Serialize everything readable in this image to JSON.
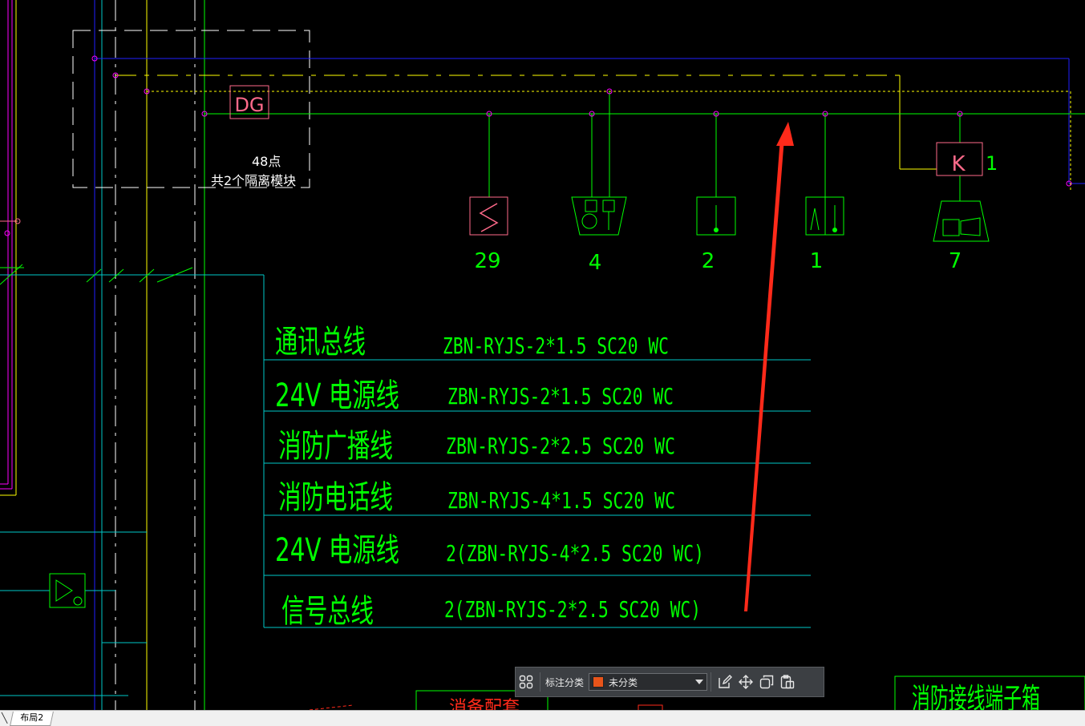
{
  "colors": {
    "background": "#000000",
    "green": "#00ff00",
    "cyan": "#00c8c8",
    "blue": "#2020ff",
    "yellow": "#ffff00",
    "magenta": "#ff00ff",
    "pink": "#ff6a8a",
    "white": "#ffffff",
    "light_green": "#80ff80",
    "red_arrow": "#ff2a1a",
    "toolbar_swatch": "#e8541a"
  },
  "drawing": {
    "dg_label": "DG",
    "dg_points": "48点",
    "dg_modules": "共2个隔离模块",
    "k_label": "K",
    "k_count": "1",
    "device_counts": [
      "29",
      "4",
      "2",
      "1",
      "7"
    ],
    "cable_table": [
      {
        "name": "通讯总线",
        "spec": "ZBN-RYJS-2*1.5  SC20  WC"
      },
      {
        "name": "24V  电源线",
        "spec": "ZBN-RYJS-2*1.5  SC20  WC"
      },
      {
        "name": "消防广播线",
        "spec": "ZBN-RYJS-2*2.5  SC20  WC"
      },
      {
        "name": "消防电话线",
        "spec": "ZBN-RYJS-4*1.5  SC20  WC"
      },
      {
        "name": "24V  电源线",
        "spec": "2(ZBN-RYJS-4*2.5  SC20  WC)"
      },
      {
        "name": "信号总线",
        "spec": "2(ZBN-RYJS-2*2.5  SC20  WC)"
      }
    ],
    "bottom_right_title": "消防接线端子箱",
    "bottom_mid_text": "消备配套"
  },
  "toolbar": {
    "label": "标注分类",
    "selected": "未分类",
    "icons": [
      "grid-apps-icon",
      "edit-icon",
      "move-icon",
      "copy-icon",
      "paste-icon"
    ]
  },
  "tabs": [
    {
      "label": "布局2"
    }
  ]
}
